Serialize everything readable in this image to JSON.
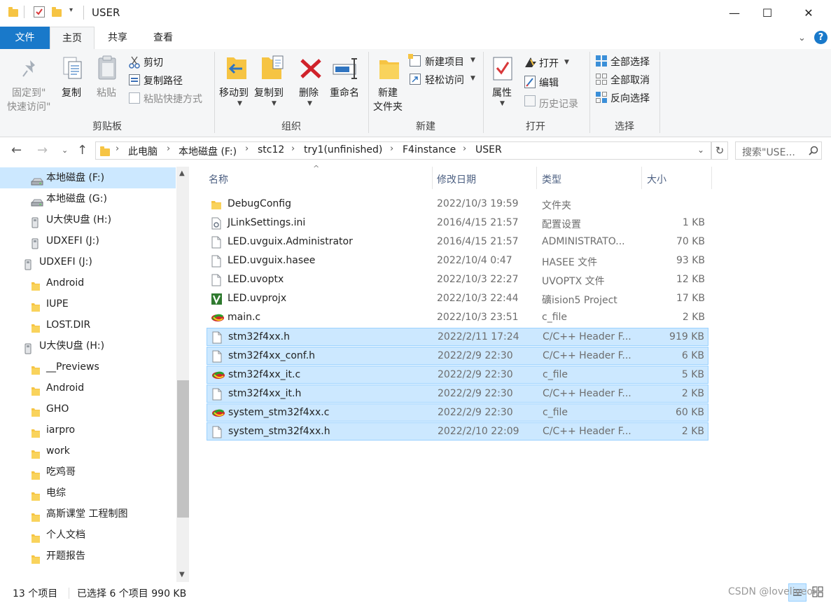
{
  "window": {
    "title": "USER",
    "controls": {
      "minimize": "—",
      "maximize": "☐",
      "close": "✕"
    }
  },
  "ribbon_tabs": [
    "文件",
    "主页",
    "共享",
    "查看"
  ],
  "ribbon": {
    "clipboard": {
      "pin_line1": "固定到\"",
      "pin_line2": "快速访问\"",
      "copy": "复制",
      "paste": "粘贴",
      "cut": "剪切",
      "copy_path": "复制路径",
      "paste_shortcut": "粘贴快捷方式",
      "group": "剪贴板"
    },
    "organize": {
      "move_to": "移动到",
      "copy_to": "复制到",
      "delete": "删除",
      "rename": "重命名",
      "group": "组织"
    },
    "new": {
      "new_folder_line1": "新建",
      "new_folder_line2": "文件夹",
      "new_item": "新建项目",
      "easy_access": "轻松访问",
      "group": "新建"
    },
    "open": {
      "properties": "属性",
      "open": "打开",
      "edit": "编辑",
      "history": "历史记录",
      "group": "打开"
    },
    "select": {
      "select_all": "全部选择",
      "select_none": "全部取消",
      "invert": "反向选择",
      "group": "选择"
    }
  },
  "address": {
    "crumbs": [
      "此电脑",
      "本地磁盘 (F:)",
      "stc12",
      "try1(unfinished)",
      "F4instance",
      "USER"
    ],
    "search_placeholder": "搜索\"USE..."
  },
  "nav": {
    "items": [
      {
        "label": "本地磁盘 (F:)",
        "icon": "drive-icon",
        "indent": 1,
        "selected": true
      },
      {
        "label": "本地磁盘 (G:)",
        "icon": "drive-icon",
        "indent": 1
      },
      {
        "label": "U大侠U盘 (H:)",
        "icon": "usb-icon",
        "indent": 1
      },
      {
        "label": "UDXEFI (J:)",
        "icon": "usb-icon",
        "indent": 1
      },
      {
        "label": "UDXEFI (J:)",
        "icon": "usb-icon",
        "indent": 0
      },
      {
        "label": "Android",
        "icon": "folder-icon",
        "indent": 1
      },
      {
        "label": "IUPE",
        "icon": "folder-icon",
        "indent": 1
      },
      {
        "label": "LOST.DIR",
        "icon": "folder-icon",
        "indent": 1
      },
      {
        "label": "U大侠U盘 (H:)",
        "icon": "usb-icon",
        "indent": 0
      },
      {
        "label": "__Previews",
        "icon": "folder-icon",
        "indent": 1
      },
      {
        "label": "Android",
        "icon": "folder-icon",
        "indent": 1
      },
      {
        "label": "GHO",
        "icon": "folder-icon",
        "indent": 1
      },
      {
        "label": "iarpro",
        "icon": "folder-icon",
        "indent": 1
      },
      {
        "label": "work",
        "icon": "folder-icon",
        "indent": 1
      },
      {
        "label": "吃鸡哥",
        "icon": "folder-icon",
        "indent": 1
      },
      {
        "label": "电综",
        "icon": "folder-icon",
        "indent": 1
      },
      {
        "label": "高斯课堂 工程制图",
        "icon": "folder-icon",
        "indent": 1
      },
      {
        "label": "个人文档",
        "icon": "folder-icon",
        "indent": 1
      },
      {
        "label": "开题报告",
        "icon": "folder-icon",
        "indent": 1
      }
    ]
  },
  "columns": {
    "name": "名称",
    "date": "修改日期",
    "type": "类型",
    "size": "大小"
  },
  "files": [
    {
      "name": "DebugConfig",
      "date": "2022/10/3 19:59",
      "type": "文件夹",
      "size": "",
      "icon": "folder-icon",
      "selected": false
    },
    {
      "name": "JLinkSettings.ini",
      "date": "2016/4/15 21:57",
      "type": "配置设置",
      "size": "1 KB",
      "icon": "settings-file-icon",
      "selected": false
    },
    {
      "name": "LED.uvguix.Administrator",
      "date": "2016/4/15 21:57",
      "type": "ADMINISTRATO...",
      "size": "70 KB",
      "icon": "file-icon",
      "selected": false
    },
    {
      "name": "LED.uvguix.hasee",
      "date": "2022/10/4 0:47",
      "type": "HASEE 文件",
      "size": "93 KB",
      "icon": "file-icon",
      "selected": false
    },
    {
      "name": "LED.uvoptx",
      "date": "2022/10/3 22:27",
      "type": "UVOPTX 文件",
      "size": "12 KB",
      "icon": "file-icon",
      "selected": false
    },
    {
      "name": "LED.uvprojx",
      "date": "2022/10/3 22:44",
      "type": "礦ision5 Project",
      "size": "17 KB",
      "icon": "keil-project-icon",
      "selected": false
    },
    {
      "name": "main.c",
      "date": "2022/10/3 23:51",
      "type": "c_file",
      "size": "2 KB",
      "icon": "c-file-icon",
      "selected": false
    },
    {
      "name": "stm32f4xx.h",
      "date": "2022/2/11 17:24",
      "type": "C/C++ Header F...",
      "size": "919 KB",
      "icon": "file-icon",
      "selected": true
    },
    {
      "name": "stm32f4xx_conf.h",
      "date": "2022/2/9 22:30",
      "type": "C/C++ Header F...",
      "size": "6 KB",
      "icon": "file-icon",
      "selected": true
    },
    {
      "name": "stm32f4xx_it.c",
      "date": "2022/2/9 22:30",
      "type": "c_file",
      "size": "5 KB",
      "icon": "c-file-icon",
      "selected": true
    },
    {
      "name": "stm32f4xx_it.h",
      "date": "2022/2/9 22:30",
      "type": "C/C++ Header F...",
      "size": "2 KB",
      "icon": "file-icon",
      "selected": true
    },
    {
      "name": "system_stm32f4xx.c",
      "date": "2022/2/9 22:30",
      "type": "c_file",
      "size": "60 KB",
      "icon": "c-file-icon",
      "selected": true
    },
    {
      "name": "system_stm32f4xx.h",
      "date": "2022/2/10 22:09",
      "type": "C/C++ Header F...",
      "size": "2 KB",
      "icon": "file-icon",
      "selected": true
    }
  ],
  "status": {
    "count": "13 个项目",
    "selection": "已选择 6 个项目  990 KB",
    "watermark": "CSDN @loveliveoil"
  },
  "colors": {
    "accent": "#1979ca",
    "selection": "#cce8ff",
    "selection_border": "#99d1ff",
    "folder": "#f6c443"
  }
}
